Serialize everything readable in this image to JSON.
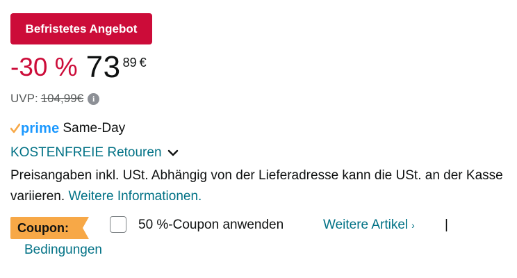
{
  "deal": {
    "badge_label": "Befristetes Angebot"
  },
  "price": {
    "savings": "-30 %",
    "whole": "73",
    "fraction": "89",
    "currency": "€"
  },
  "uvp": {
    "label": "UVP:",
    "value": "104,99€"
  },
  "delivery": {
    "prime_label": "prime",
    "speed": "Same-Day",
    "returns_label": "KOSTENFREIE Retouren"
  },
  "tax_notice": {
    "text": "Preisangaben inkl. USt. Abhängig von der Lieferadresse kann die USt. an der Kasse variieren.",
    "link": "Weitere Informationen."
  },
  "coupon": {
    "badge_label": "Coupon:",
    "apply_label": "50 %-Coupon anwenden",
    "more_items_label": "Weitere Artikel",
    "separator": "|",
    "terms_label": "Bedingungen",
    "checked": false
  },
  "colors": {
    "deal_red": "#cc0c39",
    "link_teal": "#007185",
    "prime_blue": "#1a98ff",
    "coupon_orange": "#f7a847"
  }
}
